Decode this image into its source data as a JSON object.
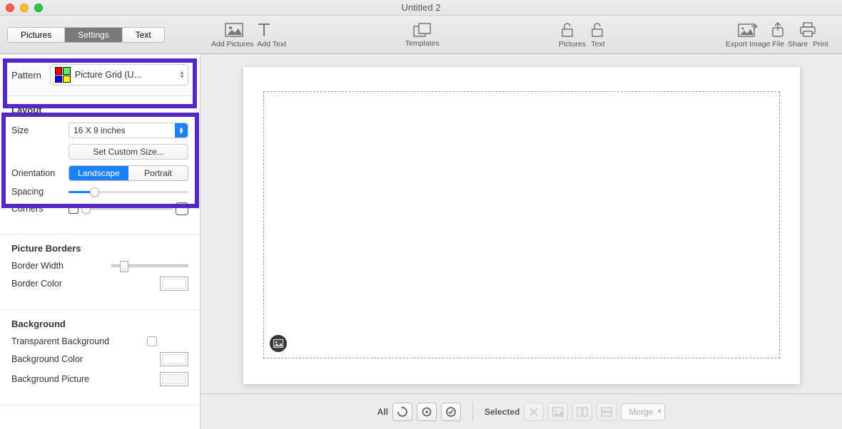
{
  "window": {
    "title": "Untitled 2"
  },
  "tabs": {
    "pictures": "Pictures",
    "settings": "Settings",
    "text": "Text"
  },
  "toolbar": {
    "add_pictures": "Add Pictures",
    "add_text": "Add Text",
    "templates": "Templates",
    "lock_pictures": "Pictures",
    "lock_text": "Text",
    "export": "Export Image File",
    "share": "Share",
    "print": "Print"
  },
  "pattern": {
    "label": "Pattern",
    "value": "Picture Grid (U..."
  },
  "layout": {
    "title": "Layout",
    "size_label": "Size",
    "size_value": "16 X 9 inches",
    "custom": "Set Custom Size...",
    "orientation_label": "Orientation",
    "landscape": "Landscape",
    "portrait": "Portrait",
    "spacing_label": "Spacing",
    "corners_label": "Corners"
  },
  "borders": {
    "title": "Picture Borders",
    "width_label": "Border Width",
    "color_label": "Border Color"
  },
  "background": {
    "title": "Background",
    "transparent_label": "Transparent Background",
    "color_label": "Background Color",
    "picture_label": "Background Picture"
  },
  "bottom": {
    "all": "All",
    "selected": "Selected",
    "merge": "Merge"
  }
}
